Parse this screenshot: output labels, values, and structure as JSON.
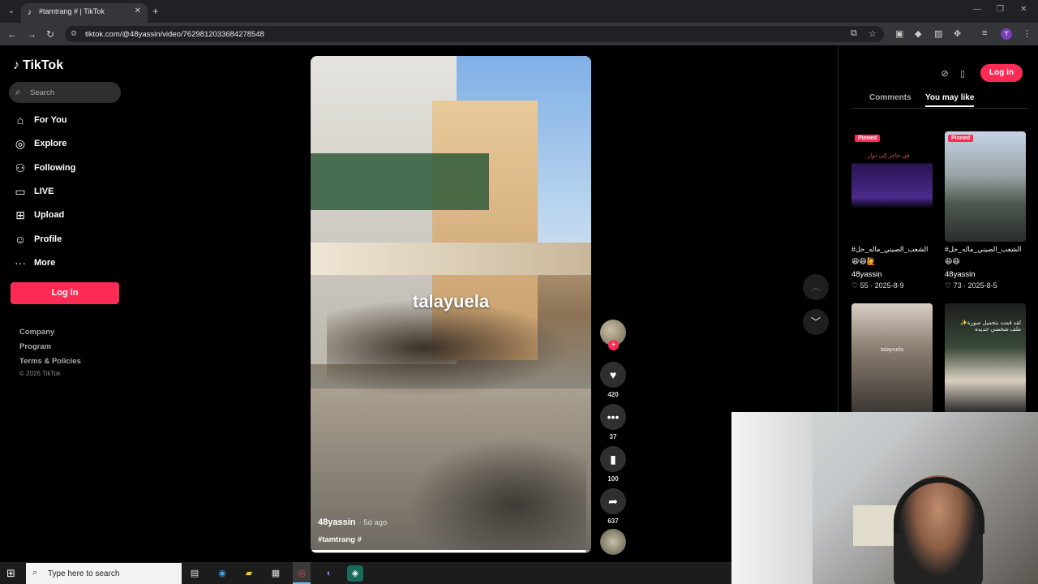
{
  "browser": {
    "tab_title": "#tamtrang # | TikTok",
    "tab_favicon": "♪",
    "tab_close": "✕",
    "new_tab": "+",
    "url": "tiktok.com/@48yassin/video/7629812033684278548",
    "profile_initial": "Y"
  },
  "sidebar": {
    "logo": "TikTok",
    "search_placeholder": "Search",
    "nav": [
      {
        "label": "For You",
        "icon": "home-icon"
      },
      {
        "label": "Explore",
        "icon": "compass-icon"
      },
      {
        "label": "Following",
        "icon": "following-icon"
      },
      {
        "label": "LIVE",
        "icon": "live-icon"
      },
      {
        "label": "Upload",
        "icon": "upload-icon"
      },
      {
        "label": "Profile",
        "icon": "profile-icon"
      },
      {
        "label": "More",
        "icon": "more-icon"
      }
    ],
    "login_label": "Log in",
    "footer": [
      "Company",
      "Program",
      "Terms & Policies"
    ],
    "copyright": "© 2026 TikTok"
  },
  "video": {
    "overlay_text": "talayuela",
    "author": "48yassin",
    "age": "· 5d ago",
    "tags": "#tamtrang #",
    "progress": 0.98
  },
  "actions": {
    "likes": "420",
    "comments": "37",
    "saves": "100",
    "shares": "637"
  },
  "right_panel": {
    "login_label": "Log in",
    "tabs": [
      "Comments",
      "You may like"
    ],
    "active_tab": "You may like",
    "cards": [
      {
        "pinned": "Pinned",
        "title": "#الشعب_الصيني_ماله_حل",
        "emoji": "😆😆🙋",
        "author": "48yassin",
        "meta": "♡ 55 · 2025-8-9",
        "thumb_overlay": "في حاجز إلى دوار"
      },
      {
        "pinned": "Pinned",
        "title": "#الشعب_الصيني_ماله_حل",
        "emoji": "😆😆",
        "author": "48yassin",
        "meta": "♡ 73 · 2025-8-5",
        "thumb_overlay": ""
      },
      {
        "pinned": "",
        "title": "",
        "emoji": "",
        "author": "",
        "meta": "",
        "thumb_overlay": "talayuela"
      },
      {
        "pinned": "",
        "title": "",
        "emoji": "",
        "author": "",
        "meta": "",
        "thumb_overlay": "✨لقد قمت بتحميل صورة ملف شخصي جديدة"
      }
    ]
  },
  "taskbar": {
    "search_placeholder": "Type here to search"
  },
  "colors": {
    "brand": "#fe2c55",
    "background": "#000000"
  }
}
